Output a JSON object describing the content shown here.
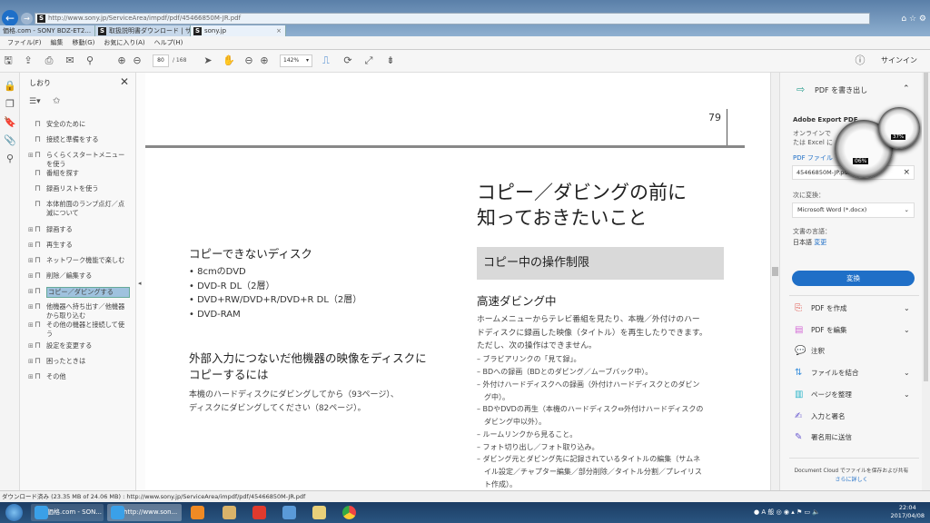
{
  "browser": {
    "url": "http://www.sony.jp/ServiceArea/impdf/pdf/45466850M-JR.pdf",
    "tabs": [
      "価格.com - SONY BDZ-ET2...",
      "取扱説明書ダウンロード | サ...",
      "sony.jp"
    ],
    "menu": [
      "ファイル(F)",
      "編集",
      "移動(G)",
      "お気に入り(A)",
      "ヘルプ(H)"
    ]
  },
  "toolbar": {
    "page_current": "80",
    "page_total": "/ 168",
    "zoom": "142%",
    "signin": "サインイン"
  },
  "bookmarks": {
    "title": "しおり",
    "items": [
      {
        "label": "安全のために",
        "expand": false
      },
      {
        "label": "接続と準備をする",
        "expand": false
      },
      {
        "label": "らくらくスタートメニューを使う",
        "expand": true
      },
      {
        "label": "番組を探す",
        "expand": false
      },
      {
        "label": "録画リストを使う",
        "expand": false
      },
      {
        "label": "本体前面のランプ点灯／点滅について",
        "expand": false
      },
      {
        "label": "録画する",
        "expand": true
      },
      {
        "label": "再生する",
        "expand": true
      },
      {
        "label": "ネットワーク機能で楽しむ",
        "expand": true
      },
      {
        "label": "削除／編集する",
        "expand": true
      },
      {
        "label": "コピー／ダビングする",
        "expand": true,
        "selected": true
      },
      {
        "label": "他機器へ持ち出す／他機器から取り込む",
        "expand": true
      },
      {
        "label": "その他の機器と接続して使う",
        "expand": true
      },
      {
        "label": "設定を変更する",
        "expand": true
      },
      {
        "label": "困ったときは",
        "expand": true
      },
      {
        "label": "その他",
        "expand": true
      }
    ]
  },
  "document": {
    "page_number": "79",
    "title_line1": "コピー／ダビングの前に",
    "title_line2": "知っておきたいこと",
    "left": {
      "heading1": "コピーできないディスク",
      "bullets": [
        "8cmのDVD",
        "DVD-R DL（2層）",
        "DVD+RW/DVD+R/DVD+R DL（2層）",
        "DVD-RAM"
      ],
      "heading2_line1": "外部入力につないだ他機器の映像をディスクに",
      "heading2_line2": "コピーするには",
      "body_line1": "本機のハードディスクにダビングしてから（93ページ）、",
      "body_line2": "ディスクにダビングしてください（82ページ）。"
    },
    "right": {
      "band": "コピー中の操作制限",
      "subheading": "高速ダビング中",
      "intro": [
        "ホームメニューからテレビ番組を見たり、本機／外付けのハー",
        "ドディスクに録画した映像（タイトル）を再生したりできます。",
        "ただし、次の操作はできません。"
      ],
      "dashes": [
        "– ブラビアリンクの「見て録」。",
        "– BDへの録画（BDとのダビング／ムーブバック中）。",
        "– 外付けハードディスクへの録画（外付けハードディスクとのダビン",
        "　グ中）。",
        "– BDやDVDの再生（本機のハードディスク⇔外付けハードディスクの",
        "　ダビング中以外）。",
        "– ルームリンクから見ること。",
        "– フォト切り出し／フォト取り込み。",
        "– ダビング元とダビング先に記録されているタイトルの編集（サムネ",
        "　イル設定／チャプター編集／部分削除／タイトル分割／プレイリス",
        "　ト作成）。"
      ]
    }
  },
  "right_pane": {
    "export_title": "PDF を書き出し",
    "adobe_export": "Adobe Export PDF",
    "desc1": "オンラインで",
    "desc2": "たは Excel に",
    "pdf_file_label": "PDF ファイル",
    "file_name": "45466850M-JP.pdf",
    "convert_to_label": "次に変換：",
    "format": "Microsoft Word (*.docx)",
    "lang_label": "文書の言語：",
    "lang": "日本語",
    "lang_change": "変更",
    "convert_button": "変換",
    "tools": [
      {
        "label": "PDF を作成",
        "icon": "create-pdf-icon",
        "chevron": true,
        "color": "#e0524a"
      },
      {
        "label": "PDF を編集",
        "icon": "edit-pdf-icon",
        "chevron": true,
        "color": "#d46ad6"
      },
      {
        "label": "注釈",
        "icon": "comment-icon",
        "chevron": false,
        "color": "#f0b429"
      },
      {
        "label": "ファイルを結合",
        "icon": "combine-files-icon",
        "chevron": true,
        "color": "#3a8fdc"
      },
      {
        "label": "ページを整理",
        "icon": "organize-pages-icon",
        "chevron": true,
        "color": "#2ab4c8"
      },
      {
        "label": "入力と署名",
        "icon": "fill-sign-icon",
        "chevron": false,
        "color": "#6a5ad0"
      },
      {
        "label": "署名用に送信",
        "icon": "send-sign-icon",
        "chevron": false,
        "color": "#6a5ad0"
      }
    ],
    "cloud_text": "Document Cloud でファイルを保存および共有",
    "learn_more": "さらに詳しく"
  },
  "gadget": {
    "cpu": "06%",
    "mem": "37%"
  },
  "status": "ダウンロード済み (23.35 MB of 24.06 MB) : http://www.sony.jp/ServiceArea/impdf/pdf/45466850M-JR.pdf",
  "taskbar": {
    "items": [
      "価格.com - SON...",
      "http://www.son..."
    ],
    "time": "22:04",
    "date": "2017/04/08"
  },
  "colors": {
    "accent": "#1f6fc7",
    "selection": "#9fc2de"
  }
}
